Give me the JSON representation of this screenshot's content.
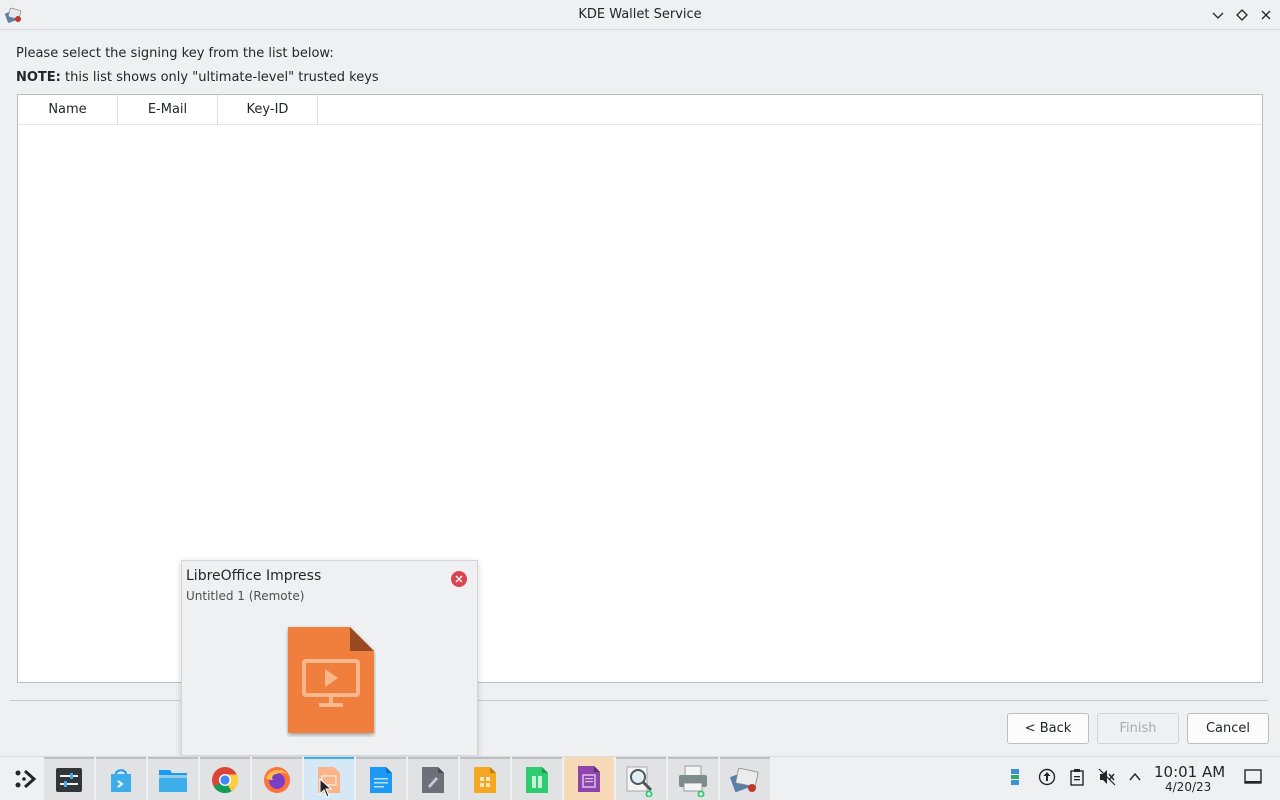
{
  "window": {
    "title": "KDE Wallet Service",
    "controls": [
      "chevron-down-icon",
      "diamond-icon",
      "close-icon"
    ]
  },
  "dialog": {
    "intro": "Please select the signing key from the list below:",
    "note_label": "NOTE:",
    "note_text": " this list shows only \"ultimate-level\" trusted keys",
    "columns": [
      "Name",
      "E-Mail",
      "Key-ID"
    ],
    "rows": [],
    "buttons": {
      "back": "< Back",
      "finish": "Finish",
      "cancel": "Cancel"
    }
  },
  "popup": {
    "title": "LibreOffice Impress",
    "subtitle": "Untitled 1 (Remote)"
  },
  "taskbar": {
    "apps": [
      {
        "name": "application-launcher",
        "icon": "launcher-icon"
      },
      {
        "name": "system-settings",
        "icon": "settings-icon"
      },
      {
        "name": "discover",
        "icon": "store-icon"
      },
      {
        "name": "dolphin",
        "icon": "folder-icon"
      },
      {
        "name": "chrome",
        "icon": "chrome-icon"
      },
      {
        "name": "firefox",
        "icon": "firefox-icon"
      },
      {
        "name": "libreoffice-impress",
        "icon": "impress-icon"
      },
      {
        "name": "libreoffice-writer",
        "icon": "writer-icon"
      },
      {
        "name": "libreoffice-draw",
        "icon": "draw-icon"
      },
      {
        "name": "libreoffice-impress-2",
        "icon": "impress-alt-icon"
      },
      {
        "name": "libreoffice-calc",
        "icon": "calc-icon"
      },
      {
        "name": "libreoffice-math",
        "icon": "math-icon"
      },
      {
        "name": "kfind",
        "icon": "magnifier-icon"
      },
      {
        "name": "printer",
        "icon": "printer-icon"
      },
      {
        "name": "kde-wallet",
        "icon": "wallet-icon"
      }
    ],
    "tray": [
      "network-icon",
      "update-icon",
      "clipboard-icon",
      "volume-muted-icon",
      "chevron-up-icon"
    ],
    "time": "10:01 AM",
    "date": "4/20/23"
  },
  "colors": {
    "accent": "#3daee9",
    "impress": "#f07f3c",
    "close_red": "#da4453"
  }
}
